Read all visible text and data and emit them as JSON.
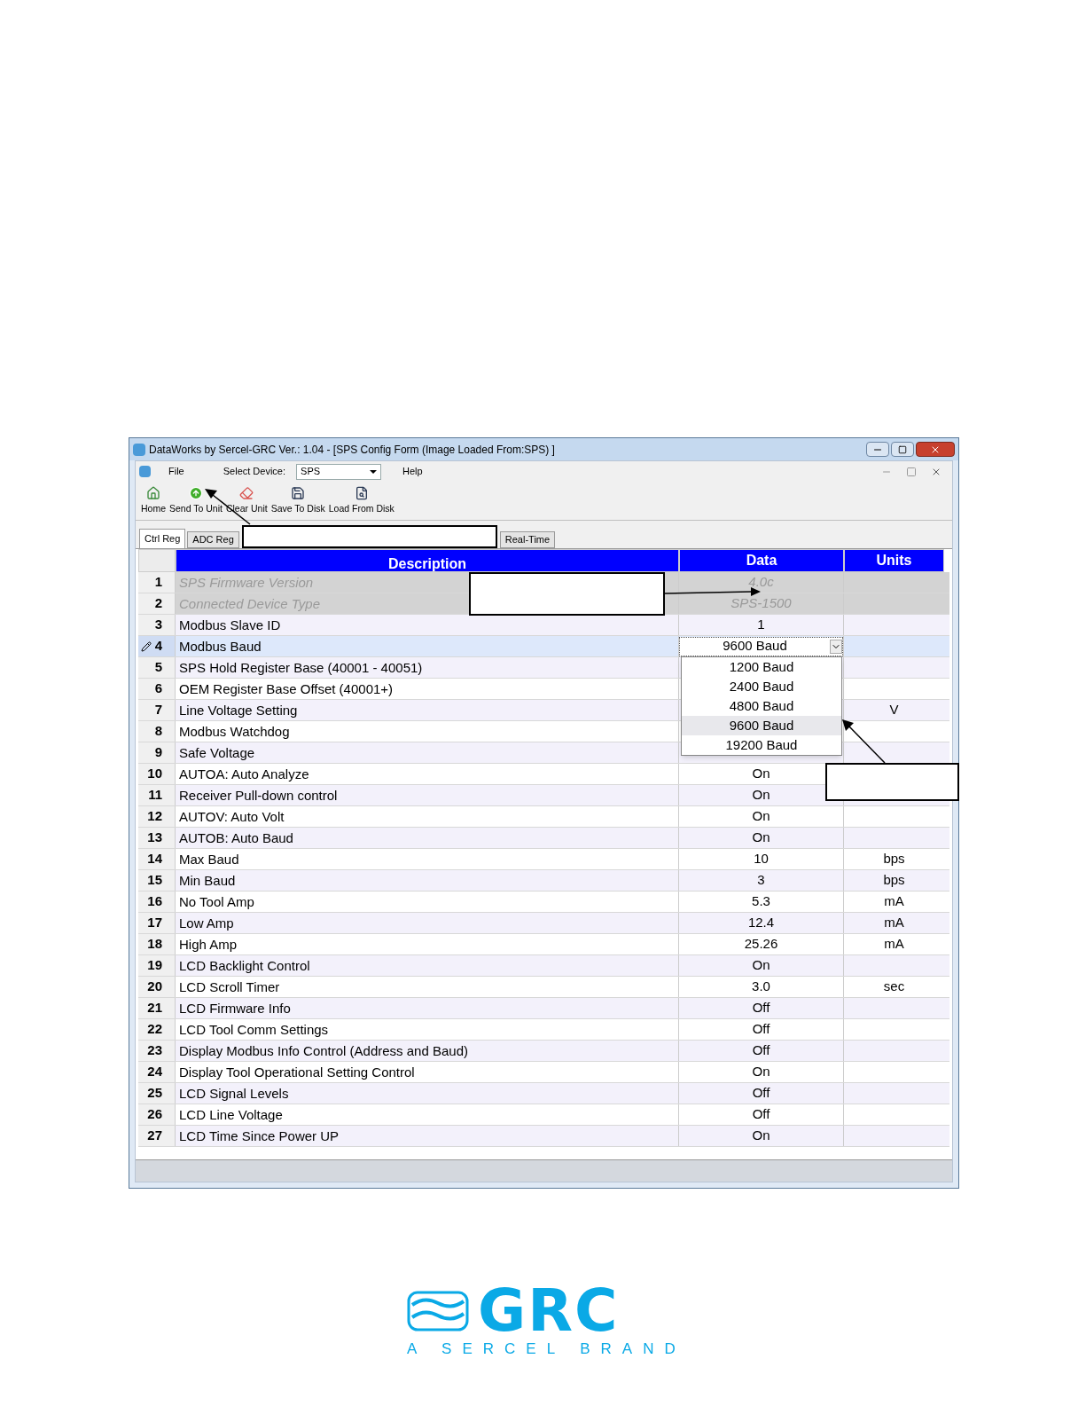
{
  "window": {
    "title": "DataWorks by Sercel-GRC Ver.: 1.04 - [SPS Config Form (Image Loaded From:SPS) ]"
  },
  "menu": {
    "file": "File",
    "device_label": "Select Device:",
    "device_value": "SPS",
    "help": "Help"
  },
  "toolbar": [
    {
      "kind": "home",
      "label": "Home"
    },
    {
      "kind": "send",
      "label": "Send To Unit"
    },
    {
      "kind": "clear",
      "label": "Clear Unit"
    },
    {
      "kind": "save",
      "label": "Save To Disk"
    },
    {
      "kind": "load",
      "label": "Load From Disk"
    }
  ],
  "tabs": [
    {
      "label": "Ctrl Reg",
      "selected": true
    },
    {
      "label": "ADC Reg",
      "selected": false
    },
    {
      "label": "Real-Time",
      "selected": false
    }
  ],
  "table": {
    "columns": [
      "Description",
      "Data",
      "Units"
    ],
    "rows": [
      {
        "number": "1",
        "description": "SPS Firmware Version",
        "data": "4.0c",
        "disabled": true,
        "selected": false
      },
      {
        "number": "2",
        "description": "Connected Device Type",
        "data": "SPS-1500",
        "disabled": true,
        "selected": false
      },
      {
        "number": "3",
        "description": "Modbus Slave ID",
        "data": "1",
        "disabled": false,
        "selected": false
      },
      {
        "number": "4",
        "description": "Modbus Baud",
        "data": "9600 Baud",
        "disabled": false,
        "selected": true
      },
      {
        "number": "5",
        "description": "SPS Hold Register Base (40001 - 40051)",
        "disabled": false,
        "selected": false
      },
      {
        "number": "6",
        "description": "OEM Register Base Offset (40001+)",
        "disabled": false,
        "selected": false
      },
      {
        "number": "7",
        "description": "Line Voltage Setting",
        "units": "V",
        "disabled": false,
        "selected": false
      },
      {
        "number": "8",
        "description": "Modbus Watchdog",
        "disabled": false,
        "selected": false
      },
      {
        "number": "9",
        "description": "Safe Voltage",
        "disabled": false,
        "selected": false
      },
      {
        "number": "10",
        "description": "AUTOA: Auto Analyze",
        "data": "On",
        "disabled": false,
        "selected": false
      },
      {
        "number": "11",
        "description": "Receiver Pull-down control",
        "data": "On",
        "disabled": false,
        "selected": false
      },
      {
        "number": "12",
        "description": "AUTOV: Auto Volt",
        "data": "On",
        "disabled": false,
        "selected": false
      },
      {
        "number": "13",
        "description": "AUTOB: Auto Baud",
        "data": "On",
        "disabled": false,
        "selected": false
      },
      {
        "number": "14",
        "description": "Max Baud",
        "data": "10",
        "units": "bps",
        "disabled": false,
        "selected": false
      },
      {
        "number": "15",
        "description": "Min Baud",
        "data": "3",
        "units": "bps",
        "disabled": false,
        "selected": false
      },
      {
        "number": "16",
        "description": "No Tool Amp",
        "data": "5.3",
        "units": "mA",
        "disabled": false,
        "selected": false
      },
      {
        "number": "17",
        "description": "Low Amp",
        "data": "12.4",
        "units": "mA",
        "disabled": false,
        "selected": false
      },
      {
        "number": "18",
        "description": "High Amp",
        "data": "25.26",
        "units": "mA",
        "disabled": false,
        "selected": false
      },
      {
        "number": "19",
        "description": "LCD Backlight Control",
        "data": "On",
        "disabled": false,
        "selected": false
      },
      {
        "number": "20",
        "description": "LCD Scroll Timer",
        "data": "3.0",
        "units": "sec",
        "disabled": false,
        "selected": false
      },
      {
        "number": "21",
        "description": "LCD Firmware Info",
        "data": "Off",
        "disabled": false,
        "selected": false
      },
      {
        "number": "22",
        "description": "LCD Tool Comm Settings",
        "data": "Off",
        "disabled": false,
        "selected": false
      },
      {
        "number": "23",
        "description": "Display Modbus Info Control (Address and Baud)",
        "data": "Off",
        "disabled": false,
        "selected": false
      },
      {
        "number": "24",
        "description": "Display Tool Operational Setting Control",
        "data": "On",
        "disabled": false,
        "selected": false
      },
      {
        "number": "25",
        "description": "LCD Signal Levels",
        "data": "Off",
        "disabled": false,
        "selected": false
      },
      {
        "number": "26",
        "description": "LCD Line Voltage",
        "data": "Off",
        "disabled": false,
        "selected": false
      },
      {
        "number": "27",
        "description": "LCD Time Since Power UP",
        "data": "On",
        "disabled": false,
        "selected": false
      }
    ],
    "dropdown": [
      {
        "label": "1200 Baud",
        "selected": false
      },
      {
        "label": "2400 Baud",
        "selected": false
      },
      {
        "label": "4800 Baud",
        "selected": false
      },
      {
        "label": "9600 Baud",
        "selected": true
      },
      {
        "label": "19200 Baud",
        "selected": false
      }
    ]
  },
  "logo": {
    "name": "GRC",
    "tagline": "A SERCEL BRAND"
  }
}
